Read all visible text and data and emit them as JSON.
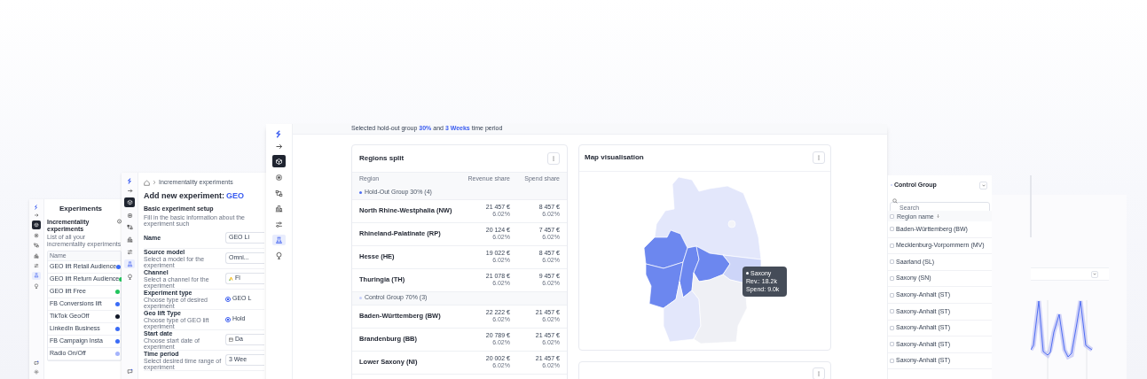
{
  "experiments_window": {
    "sidebar": [
      {
        "selected": false
      },
      {
        "selected": false
      },
      {
        "selected": false
      },
      {
        "selected": false
      },
      {
        "selected": true
      },
      {
        "selected": false
      }
    ],
    "title": "Experiments",
    "section_title": "Incrementality experiments",
    "section_subtitle": "List of all your incrementality experiments",
    "table_header": "Name",
    "rows": [
      {
        "name": "GEO lift Retail Audience",
        "color": "#3b6cf6"
      },
      {
        "name": "GEO lift Return Audience",
        "color": "#22c55e"
      },
      {
        "name": "GEO lift Free",
        "color": "#22c55e"
      },
      {
        "name": "FB Conversions lift",
        "color": "#3b6cf6"
      },
      {
        "name": "TikTok GeoOff",
        "color": "#111827"
      },
      {
        "name": "LinkedIn Business",
        "color": "#3b6cf6"
      },
      {
        "name": "FB Campaign Insta",
        "color": "#3b6cf6"
      },
      {
        "name": "Radio On/Off",
        "color": "#a5b4fc"
      }
    ]
  },
  "form_window": {
    "sidebar": [
      {
        "selected": false
      },
      {
        "selected": false
      },
      {
        "selected": false
      },
      {
        "selected": false
      },
      {
        "selected": true
      },
      {
        "selected": false
      }
    ],
    "breadcrumb": "Incrementality experiments",
    "title": "Add new experiment: ",
    "title_accent": "GEO",
    "section_title": "Basic experiment setup",
    "section_subtitle": "Fill in the basic information about the experiment such",
    "fields": [
      {
        "kind": "text",
        "label": "Name",
        "value": "GEO Li"
      },
      {
        "kind": "select",
        "label": "Source model",
        "hint": "Select a model for the experiment",
        "value": "Omni..."
      },
      {
        "kind": "channel",
        "label": "Channel",
        "hint": "Select a channel for the experiment",
        "value": "Fl"
      },
      {
        "kind": "radio",
        "label": "Experiment type",
        "hint": "Choose type of desired experiment",
        "value": "GEO L",
        "selected": true
      },
      {
        "kind": "radio",
        "label": "Geo lift Type",
        "hint": "Choose type of GEO lift experiment",
        "value": "Hold",
        "selected": true
      },
      {
        "kind": "date",
        "label": "Start date",
        "hint": "Choose start date of experiment",
        "value": "Da"
      },
      {
        "kind": "select",
        "label": "Time period",
        "hint": "Select desired time range of experiment",
        "value": "3 Wee"
      }
    ]
  },
  "main_window": {
    "sidebar": [
      {
        "selected": false
      },
      {
        "selected": false
      },
      {
        "selected": false
      },
      {
        "selected": false
      },
      {
        "selected": true
      },
      {
        "selected": false
      }
    ],
    "banner": "Selected hold-out group **30%** and **3 Weeks** time period",
    "regions_split": {
      "title": "Regions split",
      "columns": [
        "Region",
        "Revenue share",
        "Spend share"
      ],
      "groups": [
        {
          "label": "Hold-Out Group 30% (4)",
          "color": "#4f6ef2",
          "rows": [
            {
              "region": "North Rhine-Westphalia (NW)",
              "revenue": "21 457 €",
              "revenue_share": "6.02%",
              "spend": "8 457 €",
              "spend_share": "6.02%"
            },
            {
              "region": "Rhineland-Palatinate (RP)",
              "revenue": "20 124 €",
              "revenue_share": "6.02%",
              "spend": "7 457 €",
              "spend_share": "6.02%"
            },
            {
              "region": "Hesse (HE)",
              "revenue": "19 022 €",
              "revenue_share": "6.02%",
              "spend": "8 457 €",
              "spend_share": "6.02%"
            },
            {
              "region": "Thuringia (TH)",
              "revenue": "21 078 €",
              "revenue_share": "6.02%",
              "spend": "9 457 €",
              "spend_share": "6.02%"
            }
          ]
        },
        {
          "label": "Control Group 70% (3)",
          "color": "#c7d0fa",
          "rows": [
            {
              "region": "Baden-Württemberg (BW)",
              "revenue": "22 222 €",
              "revenue_share": "6.02%",
              "spend": "21 457 €",
              "spend_share": "6.02%"
            },
            {
              "region": "Brandenburg (BB)",
              "revenue": "20 789 €",
              "revenue_share": "6.02%",
              "spend": "21 457 €",
              "spend_share": "6.02%"
            },
            {
              "region": "Lower Saxony (NI)",
              "revenue": "20 002 €",
              "revenue_share": "6.02%",
              "spend": "21 457 €",
              "spend_share": "6.02%"
            }
          ]
        }
      ]
    },
    "map": {
      "title": "Map visualisation",
      "tooltip": {
        "region": "Saxony",
        "revenue": "Rev.: 18.2k",
        "spend": "Spend: 9.0k"
      }
    }
  },
  "control_group_panel": {
    "title": "Control Group",
    "search": {
      "placeholder": "Search"
    },
    "column": "Region name",
    "select_all": {
      "checked": false
    },
    "rows": [
      {
        "name": "Baden-Württemberg (BW)",
        "checked": false
      },
      {
        "name": "Mecklenburg-Vorpommern (MV)",
        "checked": false
      },
      {
        "name": "Saarland (SL)",
        "checked": false
      },
      {
        "name": "Saxony (SN)",
        "checked": false
      },
      {
        "name": "Saxony-Anhalt (ST)",
        "checked": false
      },
      {
        "name": "Saxony-Anhalt (ST)",
        "checked": false
      },
      {
        "name": "Saxony-Anhalt (ST)",
        "checked": false
      },
      {
        "name": "Saxony-Anhalt (ST)",
        "checked": false
      },
      {
        "name": "Saxony-Anhalt (ST)",
        "checked": false
      }
    ]
  }
}
